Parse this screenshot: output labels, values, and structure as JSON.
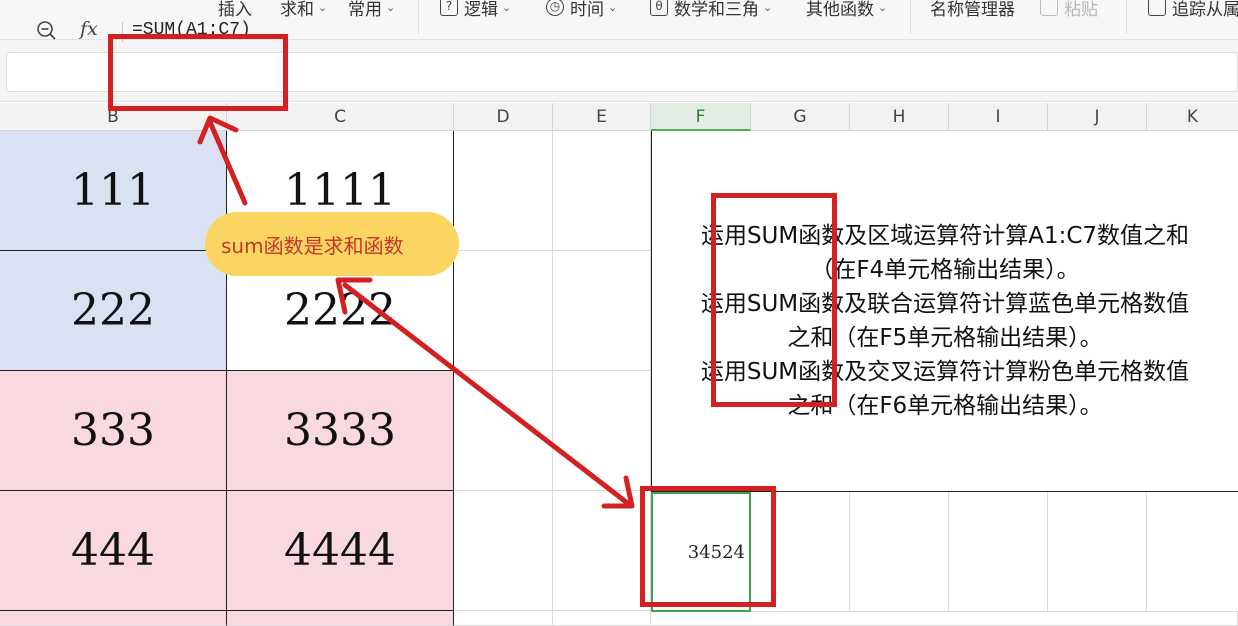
{
  "ribbon": {
    "insert": "插入",
    "sum": "求和",
    "common": "常用",
    "logic": "逻辑",
    "time": "时间",
    "math": "数学和三角",
    "other": "其他函数",
    "name_manager": "名称管理器",
    "paste": "粘贴",
    "trace": "追踪从属"
  },
  "formula_bar": {
    "fx": "fx",
    "formula": "=SUM(A1:C7)"
  },
  "columns": [
    "B",
    "C",
    "D",
    "E",
    "F",
    "G",
    "H",
    "I",
    "J",
    "K"
  ],
  "active_column": "F",
  "cells": {
    "b1": "111",
    "c1": "1111",
    "b2": "222",
    "c2": "2222",
    "b3": "333",
    "c3": "3333",
    "b4": "444",
    "c4": "4444"
  },
  "note": {
    "line1": "运用SUM函数及区域运算符计算A1:C7数值之和",
    "line2": "（在F4单元格输出结果）。",
    "line3": "运用SUM函数及联合运算符计算蓝色单元格数值",
    "line4": "之和（在F5单元格输出结果）。",
    "line5": "运用SUM函数及交叉运算符计算粉色单元格数值",
    "line6": "之和（在F6单元格输出结果）。"
  },
  "result_cell": "34524",
  "annotation": {
    "bubble": "sum函数是求和函数",
    "color": "#d42020"
  },
  "colors": {
    "blue_fill": "#d9e1f2",
    "pink_fill": "#f9d9df",
    "bubble_fill": "#fbd562",
    "active_green": "#3fa34d"
  }
}
